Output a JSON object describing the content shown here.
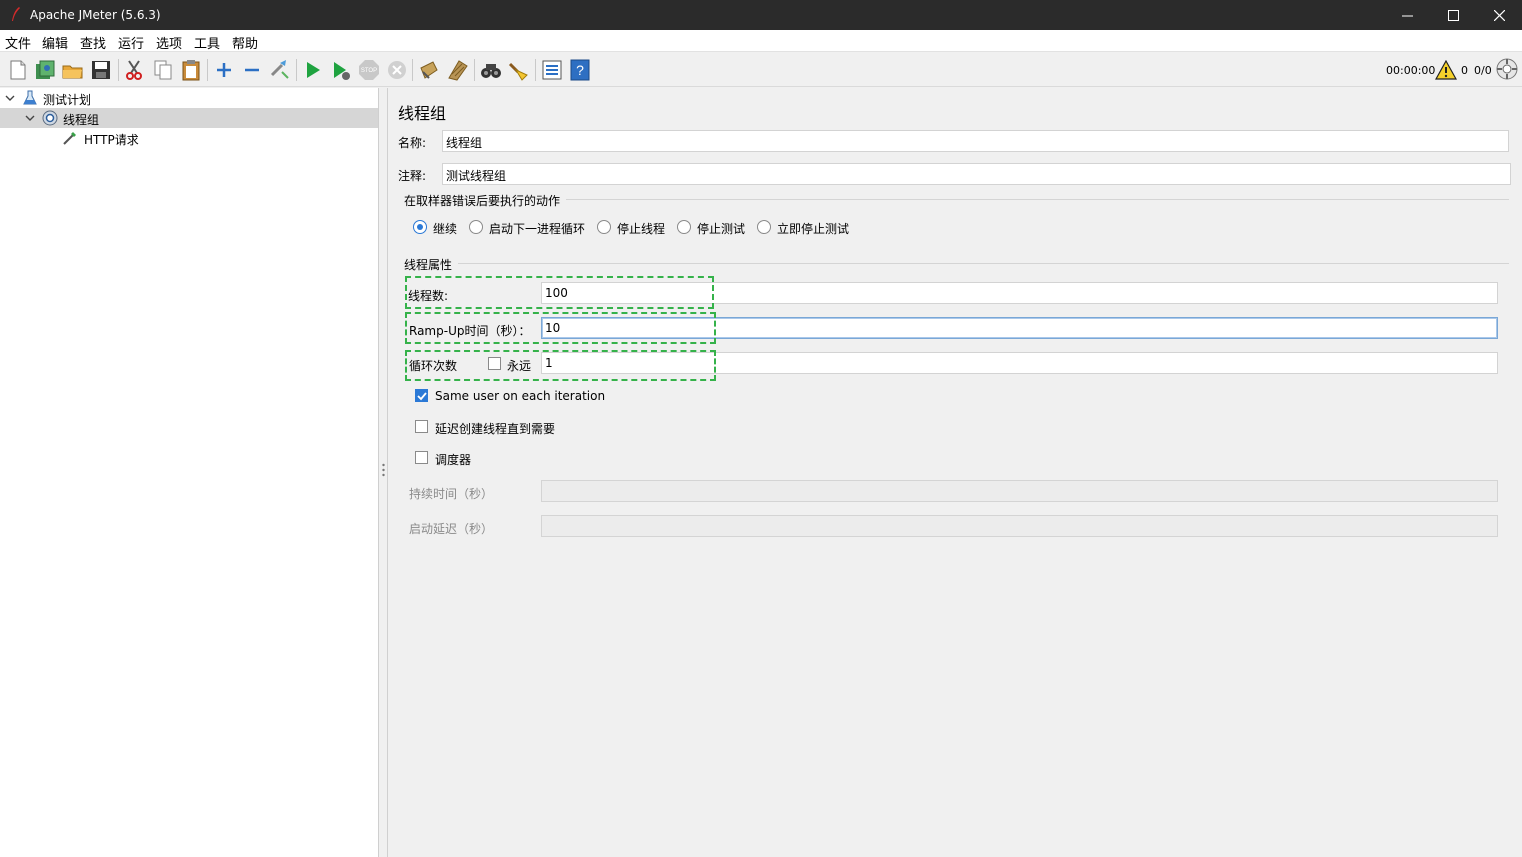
{
  "window": {
    "title": "Apache JMeter (5.6.3)"
  },
  "menu": [
    "文件",
    "编辑",
    "查找",
    "运行",
    "选项",
    "工具",
    "帮助"
  ],
  "toolbar": {
    "icons": [
      "new-icon",
      "templates-icon",
      "open-icon",
      "save-icon",
      "cut-icon",
      "copy-icon",
      "paste-icon",
      "expand-icon",
      "collapse-icon",
      "toggle-icon",
      "start-icon",
      "start-no-pause-icon",
      "stop-icon",
      "shutdown-icon",
      "clear-icon",
      "clear-all-icon",
      "search-icon",
      "reset-search-icon",
      "function-helper-icon",
      "help-icon"
    ],
    "timer": "00:00:00",
    "warning_count": "0",
    "threads": "0/0"
  },
  "tree": {
    "items": [
      {
        "label": "测试计划",
        "icon": "test-plan-icon"
      },
      {
        "label": "线程组",
        "icon": "thread-group-icon",
        "selected": true
      },
      {
        "label": "HTTP请求",
        "icon": "http-sampler-icon"
      }
    ]
  },
  "panel": {
    "heading": "线程组",
    "name_label": "名称:",
    "name_value": "线程组",
    "comment_label": "注释:",
    "comment_value": "测试线程组",
    "error_section": "在取样器错误后要执行的动作",
    "error_actions": [
      {
        "label": "继续",
        "checked": true
      },
      {
        "label": "启动下一进程循环",
        "checked": false
      },
      {
        "label": "停止线程",
        "checked": false
      },
      {
        "label": "停止测试",
        "checked": false
      },
      {
        "label": "立即停止测试",
        "checked": false
      }
    ],
    "thread_section": "线程属性",
    "threads_label": "线程数:",
    "threads_value": "100",
    "rampup_label": "Ramp-Up时间（秒）：",
    "rampup_value": "10",
    "loop_label": "循环次数",
    "forever_label": "永远",
    "loop_value": "1",
    "same_user_label": "Same user on each iteration",
    "delay_label": "延迟创建线程直到需要",
    "scheduler_label": "调度器",
    "duration_label": "持续时间（秒）",
    "startup_delay_label": "启动延迟（秒）"
  },
  "colors": {
    "accent": "#2b79d6",
    "highlight": "#35b24a",
    "titlebar": "#2b2b2b"
  }
}
